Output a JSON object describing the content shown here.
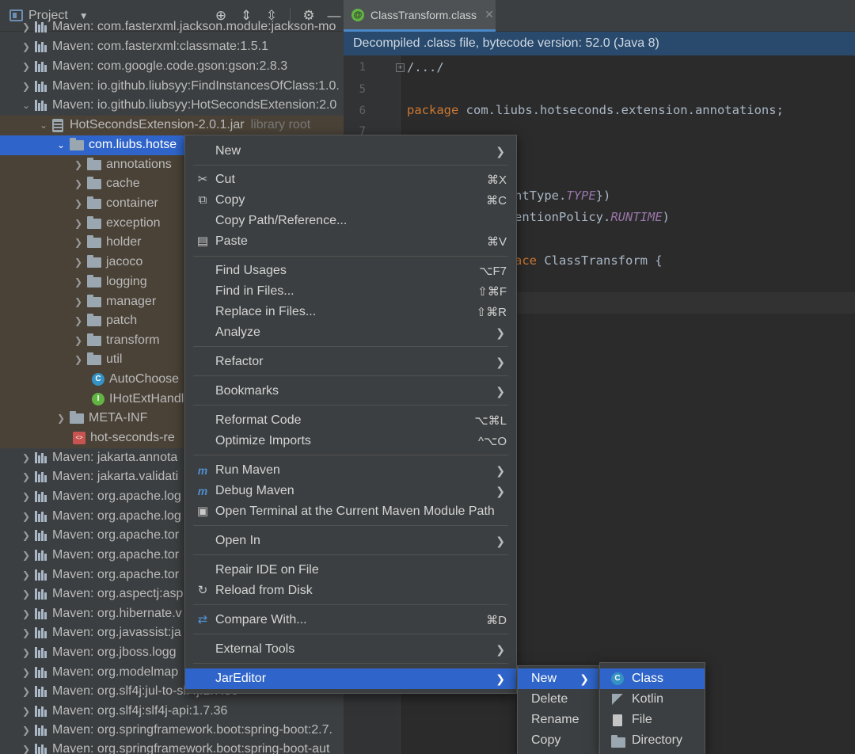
{
  "project": {
    "title": "Project",
    "rows": [
      {
        "label": "Maven: com.fasterxml.jackson.module:jackson-mo",
        "muted": ""
      },
      {
        "label": "Maven: com.fasterxml:classmate:1.5.1",
        "muted": ""
      },
      {
        "label": "Maven: com.google.code.gson:gson:2.8.3",
        "muted": ""
      },
      {
        "label": "Maven: io.github.liubsyy:FindInstancesOfClass:1.0.",
        "muted": ""
      },
      {
        "label": "Maven: io.github.liubsyy:HotSecondsExtension:2.0",
        "muted": ""
      },
      {
        "label": "HotSecondsExtension-2.0.1.jar",
        "muted": "library root"
      },
      {
        "label": "com.liubs.hotse",
        "muted": ""
      },
      {
        "label": "annotations",
        "muted": ""
      },
      {
        "label": "cache",
        "muted": ""
      },
      {
        "label": "container",
        "muted": ""
      },
      {
        "label": "exception",
        "muted": ""
      },
      {
        "label": "holder",
        "muted": ""
      },
      {
        "label": "jacoco",
        "muted": ""
      },
      {
        "label": "logging",
        "muted": ""
      },
      {
        "label": "manager",
        "muted": ""
      },
      {
        "label": "patch",
        "muted": ""
      },
      {
        "label": "transform",
        "muted": ""
      },
      {
        "label": "util",
        "muted": ""
      },
      {
        "label": "AutoChoose",
        "muted": ""
      },
      {
        "label": "IHotExtHandl",
        "muted": ""
      },
      {
        "label": "META-INF",
        "muted": ""
      },
      {
        "label": "hot-seconds-re",
        "muted": ""
      },
      {
        "label": "Maven: jakarta.annota",
        "muted": ""
      },
      {
        "label": "Maven: jakarta.validati",
        "muted": ""
      },
      {
        "label": "Maven: org.apache.log",
        "muted": ""
      },
      {
        "label": "Maven: org.apache.log",
        "muted": ""
      },
      {
        "label": "Maven: org.apache.tor",
        "muted": ""
      },
      {
        "label": "Maven: org.apache.tor",
        "muted": ""
      },
      {
        "label": "Maven: org.apache.tor",
        "muted": ""
      },
      {
        "label": "Maven: org.aspectj:asp",
        "muted": ""
      },
      {
        "label": "Maven: org.hibernate.v",
        "muted": ""
      },
      {
        "label": "Maven: org.javassist:ja",
        "muted": ""
      },
      {
        "label": "Maven: org.jboss.logg",
        "muted": ""
      },
      {
        "label": "Maven: org.modelmap",
        "muted": ""
      },
      {
        "label": "Maven: org.slf4j:jul-to-slf4j:1.7.36",
        "muted": ""
      },
      {
        "label": "Maven: org.slf4j:slf4j-api:1.7.36",
        "muted": ""
      },
      {
        "label": "Maven: org.springframework.boot:spring-boot:2.7.",
        "muted": ""
      },
      {
        "label": "Maven: org.springframework.boot:spring-boot-aut",
        "muted": ""
      }
    ]
  },
  "editor": {
    "tab_label": "ClassTransform.class",
    "banner": "Decompiled .class file, bytecode version: 52.0 (Java 8)",
    "lines": {
      "l1_num": "1",
      "l1": "/.../",
      "l5_num": "5",
      "l6_num": "6",
      "l6_kw": "package",
      "l6_rest": " com.liubs.hotseconds.extension.annotations;",
      "l7_num": "7",
      "target_a": "ntType.",
      "target_b": "TYPE",
      "target_c": "})",
      "ret_a": "entionPolicy.",
      "ret_b": "RUNTIME",
      "ret_c": ")",
      "iface_kw": "ace",
      "iface_rest": " ClassTransform {"
    }
  },
  "context_menu": {
    "new": "New",
    "cut": "Cut",
    "cut_sc": "⌘X",
    "copy": "Copy",
    "copy_sc": "⌘C",
    "copy_path": "Copy Path/Reference...",
    "paste": "Paste",
    "paste_sc": "⌘V",
    "find_usages": "Find Usages",
    "find_usages_sc": "⌥F7",
    "find_in_files": "Find in Files...",
    "find_in_files_sc": "⇧⌘F",
    "replace_in_files": "Replace in Files...",
    "replace_in_files_sc": "⇧⌘R",
    "analyze": "Analyze",
    "refactor": "Refactor",
    "bookmarks": "Bookmarks",
    "reformat": "Reformat Code",
    "reformat_sc": "⌥⌘L",
    "optimize": "Optimize Imports",
    "optimize_sc": "^⌥O",
    "run_maven": "Run Maven",
    "debug_maven": "Debug Maven",
    "open_terminal": "Open Terminal at the Current Maven Module Path",
    "open_in": "Open In",
    "repair_ide": "Repair IDE on File",
    "reload": "Reload from Disk",
    "compare": "Compare With...",
    "compare_sc": "⌘D",
    "external_tools": "External Tools",
    "jareditor": "JarEditor"
  },
  "submenu_jareditor": {
    "new": "New",
    "delete": "Delete",
    "rename": "Rename",
    "copy": "Copy"
  },
  "submenu_new": {
    "class": "Class",
    "kotlin": "Kotlin",
    "file": "File",
    "directory": "Directory"
  },
  "colors": {
    "selection": "#2f65ca",
    "banner": "#294a6c",
    "keyword": "#cc7832"
  }
}
